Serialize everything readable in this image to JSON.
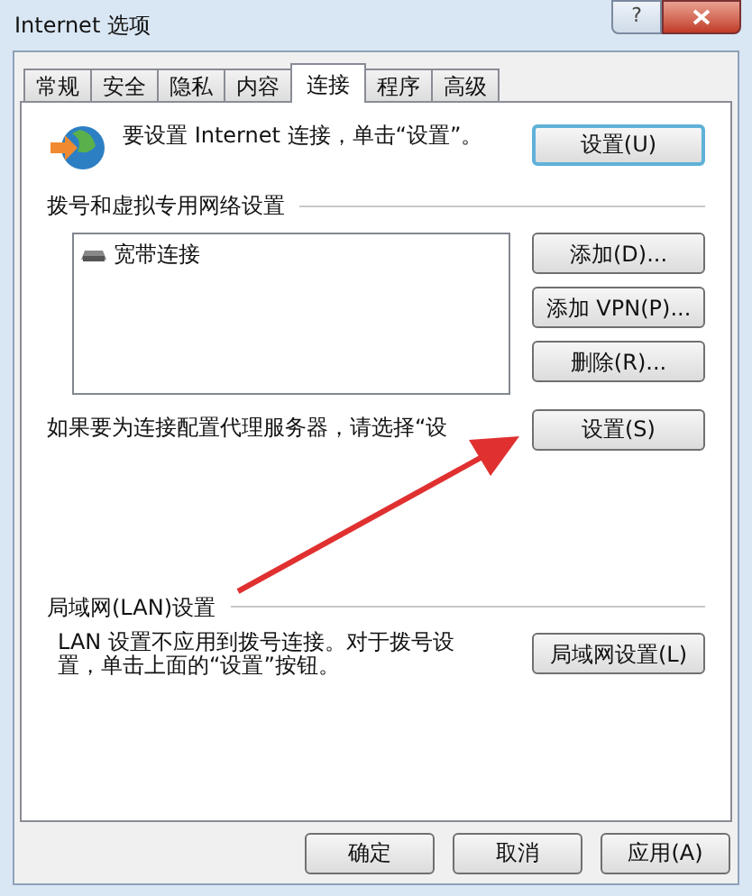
{
  "window": {
    "title": "Internet 选项",
    "help_glyph": "?"
  },
  "tabs": [
    {
      "label": "常规",
      "selected": false
    },
    {
      "label": "安全",
      "selected": false
    },
    {
      "label": "隐私",
      "selected": false
    },
    {
      "label": "内容",
      "selected": false
    },
    {
      "label": "连接",
      "selected": true
    },
    {
      "label": "程序",
      "selected": false
    },
    {
      "label": "高级",
      "selected": false
    }
  ],
  "setup": {
    "text": "要设置 Internet 连接，单击“设置”。",
    "button": {
      "label": "设置(U)",
      "default": true
    }
  },
  "dialup": {
    "heading": "拨号和虚拟专用网络设置",
    "connections": [
      {
        "label": "宽带连接",
        "selected": false
      }
    ],
    "buttons": [
      {
        "label": "添加(D)...",
        "default": false
      },
      {
        "label": "添加 VPN(P)...",
        "default": false
      },
      {
        "label": "删除(R)...",
        "default": false
      }
    ],
    "proxy_text": "如果要为连接配置代理服务器，请选择“设",
    "proxy_button": {
      "label": "设置(S)",
      "default": false
    }
  },
  "lan": {
    "heading": "局域网(LAN)设置",
    "text": "LAN 设置不应用到拨号连接。对于拨号设置，单击上面的“设置”按钮。",
    "button": {
      "label": "局域网设置(L)",
      "default": false
    }
  },
  "footer_buttons": [
    {
      "label": "确定",
      "default": false
    },
    {
      "label": "取消",
      "default": false
    },
    {
      "label": "应用(A)",
      "default": false
    }
  ]
}
